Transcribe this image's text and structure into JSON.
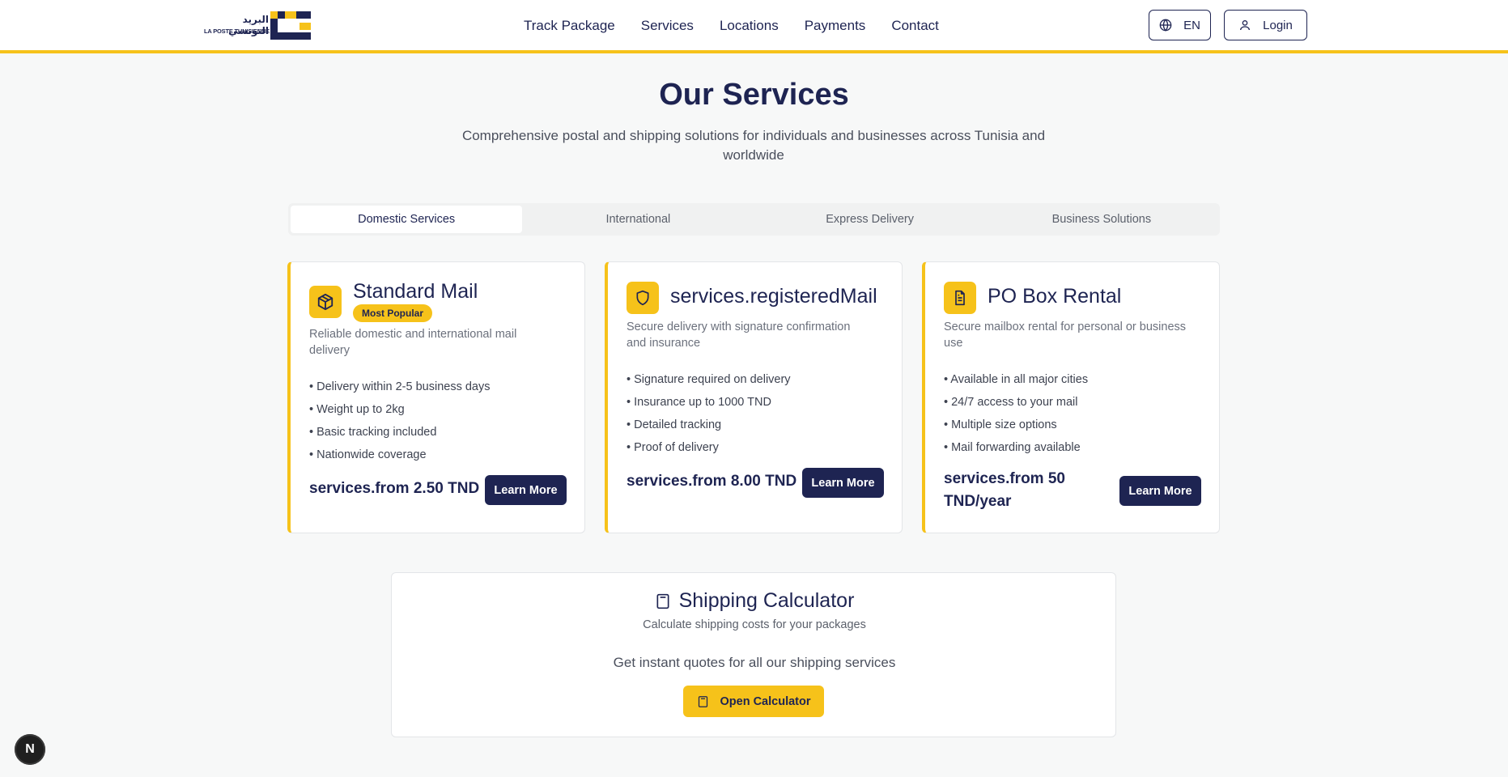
{
  "header": {
    "logo": {
      "arabic": "البريد التونسي",
      "french": "LA POSTE TUNISIENNE"
    },
    "nav": [
      "Track Package",
      "Services",
      "Locations",
      "Payments",
      "Contact"
    ],
    "language": "EN",
    "login": "Login"
  },
  "hero": {
    "title": "Our Services",
    "subtitle": "Comprehensive postal and shipping solutions for individuals and businesses across Tunisia and worldwide"
  },
  "tabs": [
    {
      "label": "Domestic Services",
      "active": true
    },
    {
      "label": "International",
      "active": false
    },
    {
      "label": "Express Delivery",
      "active": false
    },
    {
      "label": "Business Solutions",
      "active": false
    }
  ],
  "cards": [
    {
      "icon": "package-icon",
      "title": "Standard Mail",
      "badge": "Most Popular",
      "description": "Reliable domestic and international mail delivery",
      "features": [
        "• Delivery within 2-5 business days",
        "• Weight up to 2kg",
        "• Basic tracking included",
        "• Nationwide coverage"
      ],
      "price": "services.from 2.50 TND",
      "button": "Learn More"
    },
    {
      "icon": "shield-icon",
      "title": "services.registeredMail",
      "description": "Secure delivery with signature confirmation and insurance",
      "features": [
        "• Signature required on delivery",
        "• Insurance up to 1000 TND",
        "• Detailed tracking",
        "• Proof of delivery"
      ],
      "price": "services.from 8.00 TND",
      "button": "Learn More"
    },
    {
      "icon": "document-icon",
      "title": "PO Box Rental",
      "description": "Secure mailbox rental for personal or business use",
      "features": [
        "• Available in all major cities",
        "• 24/7 access to your mail",
        "• Multiple size options",
        "• Mail forwarding available"
      ],
      "price": "services.from 50 TND/year",
      "button": "Learn More"
    }
  ],
  "calculator": {
    "title": "Shipping Calculator",
    "subtitle": "Calculate shipping costs for your packages",
    "text": "Get instant quotes for all our shipping services",
    "button": "Open Calculator"
  },
  "dev_badge": "N",
  "colors": {
    "accent": "#f6c21a",
    "brand": "#1e2452",
    "background": "#f7f8f8"
  }
}
